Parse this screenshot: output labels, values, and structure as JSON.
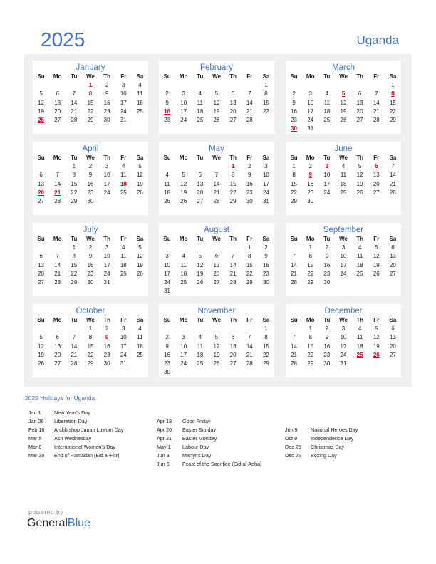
{
  "header": {
    "year": "2025",
    "country": "Uganda"
  },
  "weekdays": [
    "Su",
    "Mo",
    "Tu",
    "We",
    "Th",
    "Fr",
    "Sa"
  ],
  "colors": {
    "accent": "#4472c4",
    "holiday": "#e0001b",
    "panel_bg": "#f0f0f0"
  },
  "months": [
    {
      "name": "January",
      "start": 3,
      "days": 31,
      "holidays": [
        1,
        26
      ]
    },
    {
      "name": "February",
      "start": 6,
      "days": 28,
      "holidays": [
        16
      ]
    },
    {
      "name": "March",
      "start": 6,
      "days": 31,
      "holidays": [
        5,
        8,
        30
      ]
    },
    {
      "name": "April",
      "start": 2,
      "days": 30,
      "holidays": [
        18,
        20,
        21
      ]
    },
    {
      "name": "May",
      "start": 4,
      "days": 31,
      "holidays": [
        1
      ]
    },
    {
      "name": "June",
      "start": 0,
      "days": 30,
      "holidays": [
        3,
        6,
        9
      ]
    },
    {
      "name": "July",
      "start": 2,
      "days": 31,
      "holidays": []
    },
    {
      "name": "August",
      "start": 5,
      "days": 31,
      "holidays": []
    },
    {
      "name": "September",
      "start": 1,
      "days": 30,
      "holidays": []
    },
    {
      "name": "October",
      "start": 3,
      "days": 31,
      "holidays": [
        9
      ]
    },
    {
      "name": "November",
      "start": 6,
      "days": 30,
      "holidays": []
    },
    {
      "name": "December",
      "start": 1,
      "days": 31,
      "holidays": [
        25,
        26
      ]
    }
  ],
  "holidays_title": "2025 Holidays for Uganda",
  "holidays": [
    [
      {
        "date": "Jan 1",
        "name": "New Year’s Day"
      },
      {
        "date": "Jan 26",
        "name": "Liberation Day"
      },
      {
        "date": "Feb 16",
        "name": "Archbishop Janan Luwum Day"
      },
      {
        "date": "Mar 5",
        "name": "Ash Wednesday"
      },
      {
        "date": "Mar 8",
        "name": "International Women’s Day"
      },
      {
        "date": "Mar 30",
        "name": "End of Ramadan (Eid al-Fitr)"
      }
    ],
    [
      {
        "date": "Apr 18",
        "name": "Good Friday"
      },
      {
        "date": "Apr 20",
        "name": "Easter Sunday"
      },
      {
        "date": "Apr 21",
        "name": "Easter Monday"
      },
      {
        "date": "May 1",
        "name": "Labour Day"
      },
      {
        "date": "Jun 3",
        "name": "Martyr’s Day"
      },
      {
        "date": "Jun 6",
        "name": "Feast of the Sacrifice (Eid al-Adha)"
      }
    ],
    [
      {
        "date": "Jun 9",
        "name": "National Heroes Day"
      },
      {
        "date": "Oct 9",
        "name": "Independence Day"
      },
      {
        "date": "Dec 25",
        "name": "Christmas Day"
      },
      {
        "date": "Dec 26",
        "name": "Boxing Day"
      }
    ]
  ],
  "footer": {
    "powered_by": "powered by",
    "brand_general": "General",
    "brand_blue": "Blue"
  }
}
